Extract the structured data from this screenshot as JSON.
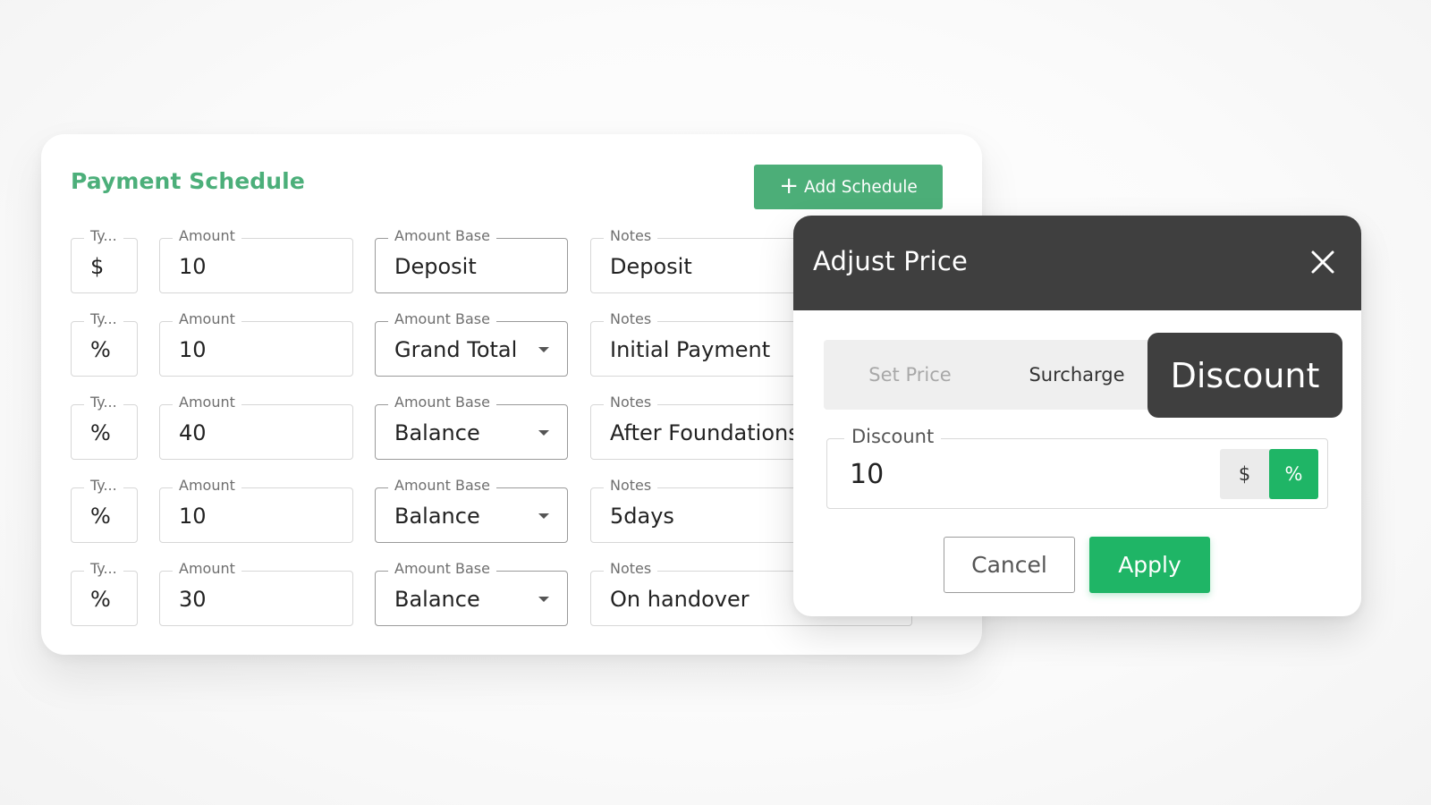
{
  "schedule": {
    "title": "Payment Schedule",
    "add_label": "Add Schedule",
    "add_icon": "plus-icon",
    "field_labels": {
      "type": "Ty...",
      "amount": "Amount",
      "amount_base": "Amount Base",
      "notes": "Notes"
    },
    "rows": [
      {
        "type": "$",
        "amount": "10",
        "amount_base": "Deposit",
        "notes": "Deposit"
      },
      {
        "type": "%",
        "amount": "10",
        "amount_base": "Grand Total",
        "notes": "Initial Payment"
      },
      {
        "type": "%",
        "amount": "40",
        "amount_base": "Balance",
        "notes": "After Foundations"
      },
      {
        "type": "%",
        "amount": "10",
        "amount_base": "Balance",
        "notes": "5days"
      },
      {
        "type": "%",
        "amount": "30",
        "amount_base": "Balance",
        "notes": "On handover"
      }
    ]
  },
  "dialog": {
    "title": "Adjust Price",
    "close_icon": "close-icon",
    "tabs": [
      {
        "label": "Set Price",
        "active": false
      },
      {
        "label": "Surcharge",
        "active": false
      },
      {
        "label": "Discount",
        "active": true
      }
    ],
    "discount_field": {
      "label": "Discount",
      "value": "10",
      "units": [
        "$",
        "%"
      ],
      "selected_unit": "%"
    },
    "cancel_label": "Cancel",
    "apply_label": "Apply"
  },
  "colors": {
    "brand_green": "#4caf7a",
    "accent_green": "#1fb566",
    "header_dark": "#3f3f3f"
  }
}
